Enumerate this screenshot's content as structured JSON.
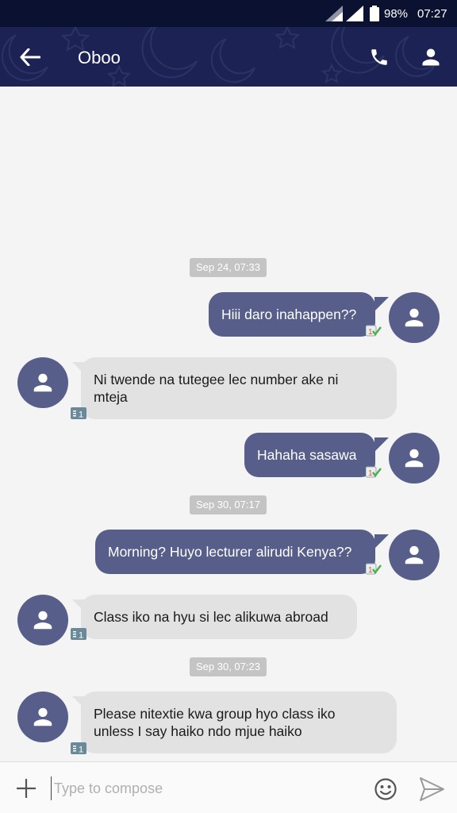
{
  "status_bar": {
    "battery": "98%",
    "time": "07:27"
  },
  "app_bar": {
    "title": "Oboo",
    "icons": [
      "back-arrow-icon",
      "phone-icon",
      "person-icon"
    ]
  },
  "conversation": {
    "date_chips": [
      "Sep 24, 07:33",
      "Sep 30, 07:17",
      "Sep 30, 07:23"
    ],
    "messages": [
      {
        "direction": "outgoing",
        "lines": [
          "Hiii daro inahappen??"
        ],
        "status_icon": "sim1-delivered-icon"
      },
      {
        "direction": "incoming",
        "lines": [
          "Ni twende na tutegee lec number ake ni",
          "mteja"
        ],
        "status_icon": "sim1-icon"
      },
      {
        "direction": "outgoing",
        "lines": [
          "Hahaha sasawa"
        ],
        "status_icon": "sim1-delivered-icon"
      },
      {
        "direction": "outgoing",
        "lines": [
          "Morning? Huyo lecturer alirudi Kenya??"
        ],
        "status_icon": "sim1-delivered-icon"
      },
      {
        "direction": "incoming",
        "lines": [
          "Class iko na hyu si lec alikuwa abroad"
        ],
        "status_icon": "sim1-icon"
      },
      {
        "direction": "incoming",
        "lines": [
          "Please nitextie kwa group hyo class iko",
          "unless I say haiko ndo mjue haiko"
        ],
        "status_icon": "sim1-icon"
      }
    ]
  },
  "compose": {
    "placeholder": "Type to compose",
    "icons": [
      "plus-icon",
      "emoji-icon",
      "send-icon"
    ]
  },
  "colors": {
    "app_bar": "#1c2354",
    "status_bar": "#0b1130",
    "outgoing_bubble": "#575e8a",
    "incoming_bubble": "#e2e2e2",
    "avatar": "#575e8a",
    "background": "#f4f4f4"
  }
}
